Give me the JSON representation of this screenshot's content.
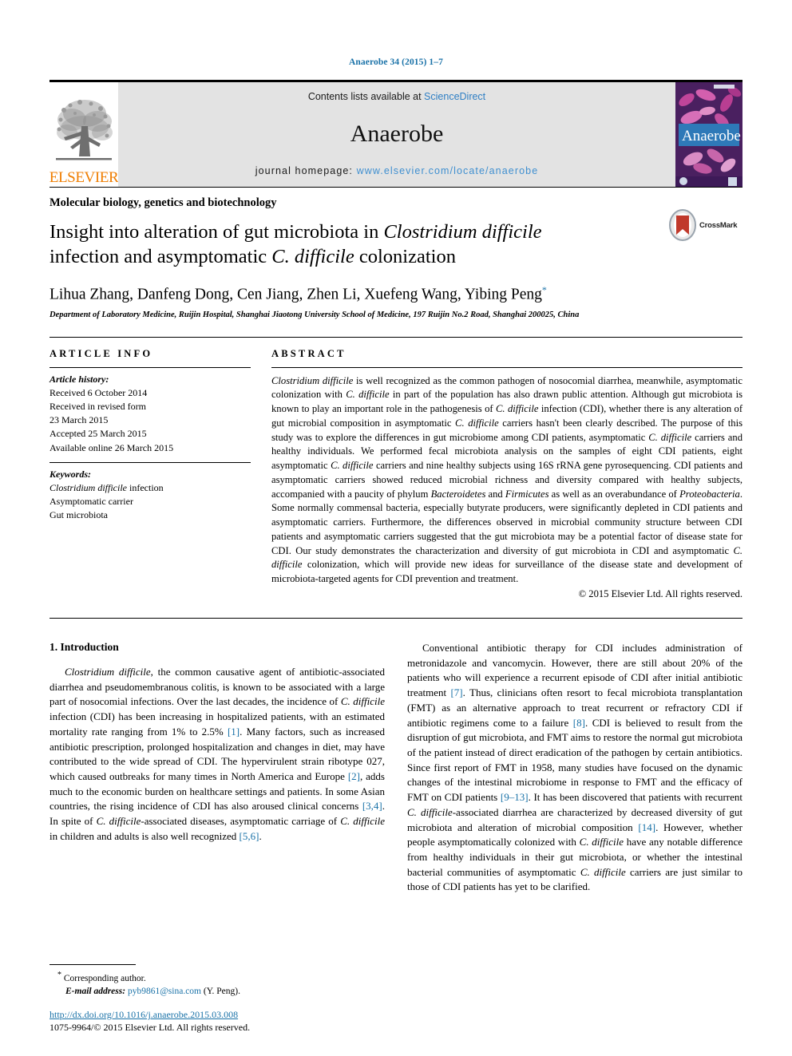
{
  "running_head": "Anaerobe 34 (2015) 1–7",
  "masthead": {
    "publisher_name": "ELSEVIER",
    "contents_prefix": "Contents lists available at ",
    "sciencedirect_link": "ScienceDirect",
    "journal_name": "Anaerobe",
    "homepage_prefix": "journal homepage: ",
    "homepage_url": "www.elsevier.com/locate/anaerobe",
    "cover_title": "Anaerobe"
  },
  "article": {
    "section_tag": "Molecular biology, genetics and biotechnology",
    "title_line1_a": "Insight into alteration of gut microbiota in ",
    "title_line1_b": "Clostridium difficile",
    "title_line2_a": "infection and asymptomatic ",
    "title_line2_b": "C. difficile",
    "title_line2_c": " colonization",
    "crossmark_label": "CrossMark",
    "authors": "Lihua Zhang, Danfeng Dong, Cen Jiang, Zhen Li, Xuefeng Wang, Yibing Peng",
    "affiliation": "Department of Laboratory Medicine, Ruijin Hospital, Shanghai Jiaotong University School of Medicine, 197 Ruijin No.2 Road, Shanghai 200025, China"
  },
  "info": {
    "heading": "ARTICLE INFO",
    "history_title": "Article history:",
    "history_lines": [
      "Received 6 October 2014",
      "Received in revised form",
      "23 March 2015",
      "Accepted 25 March 2015",
      "Available online 26 March 2015"
    ],
    "keywords_title": "Keywords:",
    "keyword_1_italic": "Clostridium difficile",
    "keyword_1_rest": " infection",
    "keyword_2": "Asymptomatic carrier",
    "keyword_3": "Gut microbiota"
  },
  "abstract": {
    "heading": "ABSTRACT",
    "p1": "Clostridium difficile",
    "p2": " is well recognized as the common pathogen of nosocomial diarrhea, meanwhile, asymptomatic colonization with ",
    "p3": "C. difficile",
    "p4": " in part of the population has also drawn public attention. Although gut microbiota is known to play an important role in the pathogenesis of ",
    "p5": "C. difficile",
    "p6": " infection (CDI), whether there is any alteration of gut microbial composition in asymptomatic ",
    "p7": "C. difficile",
    "p8": " carriers hasn't been clearly described. The purpose of this study was to explore the differences in gut microbiome among CDI patients, asymptomatic ",
    "p9": "C. difficile",
    "p10": " carriers and healthy individuals. We performed fecal microbiota analysis on the samples of eight CDI patients, eight asymptomatic ",
    "p11": "C. difficile",
    "p12": " carriers and nine healthy subjects using 16S rRNA gene pyrosequencing. CDI patients and asymptomatic carriers showed reduced microbial richness and diversity compared with healthy subjects, accompanied with a paucity of phylum ",
    "p13": "Bacteroidetes",
    "p14": " and ",
    "p15": "Firmicutes",
    "p16": " as well as an overabundance of ",
    "p17": "Proteobacteria",
    "p18": ". Some normally commensal bacteria, especially butyrate producers, were significantly depleted in CDI patients and asymptomatic carriers. Furthermore, the differences observed in microbial community structure between CDI patients and asymptomatic carriers suggested that the gut microbiota may be a potential factor of disease state for CDI. Our study demonstrates the characterization and diversity of gut microbiota in CDI and asymptomatic ",
    "p19": "C. difficile",
    "p20": " colonization, which will provide new ideas for surveillance of the disease state and development of microbiota-targeted agents for CDI prevention and treatment.",
    "copyright": "© 2015 Elsevier Ltd. All rights reserved."
  },
  "intro": {
    "heading": "1. Introduction",
    "left_1": "Clostridium difficile",
    "left_2": ", the common causative agent of antibiotic-associated diarrhea and pseudomembranous colitis, is known to be associated with a large part of nosocomial infections. Over the last decades, the incidence of ",
    "left_3": "C. difficile",
    "left_4": " infection (CDI) has been increasing in hospitalized patients, with an estimated mortality rate ranging from 1% to 2.5% ",
    "ref_1": "[1]",
    "left_5": ". Many factors, such as increased antibiotic prescription, prolonged hospitalization and changes in diet, may have contributed to the wide spread of CDI. The hypervirulent strain ribotype 027, which caused outbreaks for many times in North America and Europe ",
    "ref_2": "[2]",
    "left_6": ", adds much to the economic burden on healthcare settings and patients. In some Asian countries, the rising incidence of CDI has also aroused clinical concerns ",
    "ref_34": "[3,4]",
    "left_7": ". In spite of ",
    "left_8": "C. difficile",
    "left_9": "-associated diseases, asymptomatic carriage of ",
    "left_10": "C. difficile",
    "left_11": " in children and adults is also well recognized ",
    "ref_56": "[5,6]",
    "left_12": ".",
    "right_1": "Conventional antibiotic therapy for CDI includes administration of metronidazole and vancomycin. However, there are still about 20% of the patients who will experience a recurrent episode of CDI after initial antibiotic treatment ",
    "ref_7": "[7]",
    "right_2": ". Thus, clinicians often resort to fecal microbiota transplantation (FMT) as an alternative approach to treat recurrent or refractory CDI if antibiotic regimens come to a failure ",
    "ref_8": "[8]",
    "right_3": ". CDI is believed to result from the disruption of gut microbiota, and FMT aims to restore the normal gut microbiota of the patient instead of direct eradication of the pathogen by certain antibiotics. Since first report of FMT in 1958, many studies have focused on the dynamic changes of the intestinal microbiome in response to FMT and the efficacy of FMT on CDI patients ",
    "ref_913": "[9–13]",
    "right_4": ". It has been discovered that patients with recurrent ",
    "right_5": "C. difficile",
    "right_6": "-associated diarrhea are characterized by decreased diversity of gut microbiota and alteration of microbial composition ",
    "ref_14": "[14]",
    "right_7": ". However, whether people asymptomatically colonized with ",
    "right_8": "C. difficile",
    "right_9": " have any notable difference from healthy individuals in their gut microbiota, or whether the intestinal bacterial communities of asymptomatic ",
    "right_10": "C. difficile",
    "right_11": " carriers are just similar to those of CDI patients has yet to be clarified."
  },
  "footer": {
    "corresponding_star": "*",
    "corresponding_label": " Corresponding author.",
    "email_label": "E-mail address:",
    "email": "pyb9861@sina.com",
    "email_suffix": " (Y. Peng).",
    "doi": "http://dx.doi.org/10.1016/j.anaerobe.2015.03.008",
    "issn_line": "1075-9964/© 2015 Elsevier Ltd. All rights reserved."
  },
  "colors": {
    "link_blue": "#1a72a8",
    "sciencedirect_blue": "#2f7fc4",
    "elsevier_orange": "#ef7d00",
    "band_grey": "#e3e3e3"
  }
}
